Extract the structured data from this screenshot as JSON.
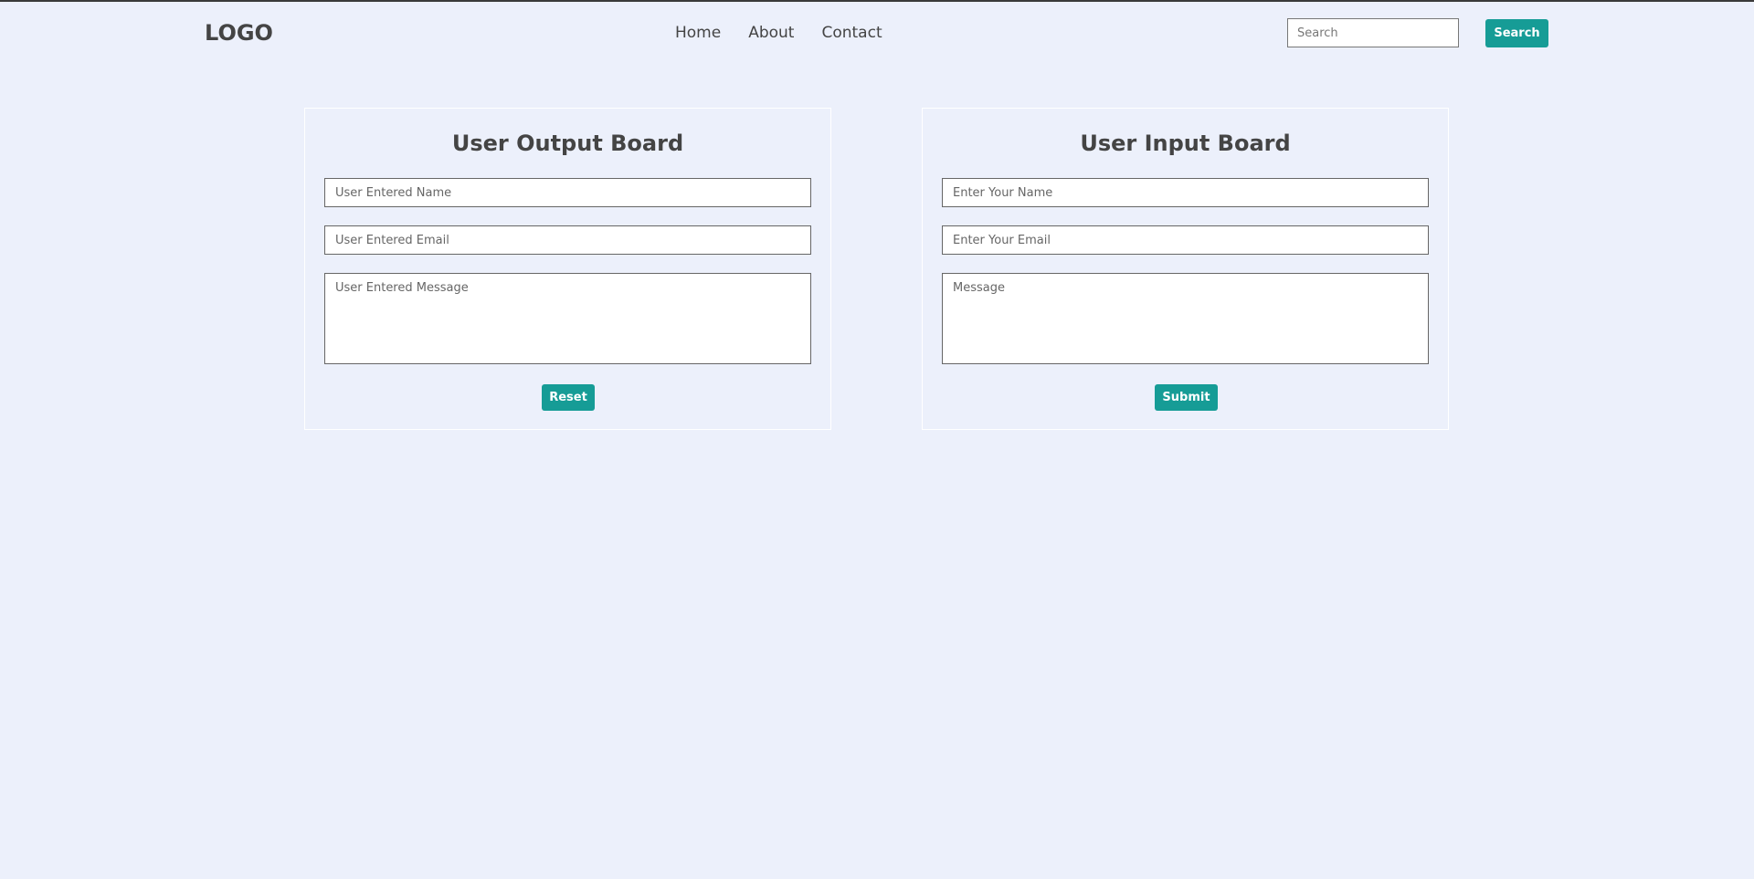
{
  "header": {
    "logo": "LOGO",
    "nav": [
      "Home",
      "About",
      "Contact"
    ],
    "search": {
      "placeholder": "Search",
      "button_label": "Search"
    }
  },
  "output_board": {
    "title": "User Output Board",
    "name_placeholder": "User Entered Name",
    "email_placeholder": "User Entered Email",
    "message_placeholder": "User Entered Message",
    "button_label": "Reset"
  },
  "input_board": {
    "title": "User Input Board",
    "name_placeholder": "Enter Your Name",
    "email_placeholder": "Enter Your Email",
    "message_placeholder": "Message",
    "button_label": "Submit"
  },
  "colors": {
    "background": "#ecf0fb",
    "accent": "#169c96",
    "text": "#444444"
  }
}
